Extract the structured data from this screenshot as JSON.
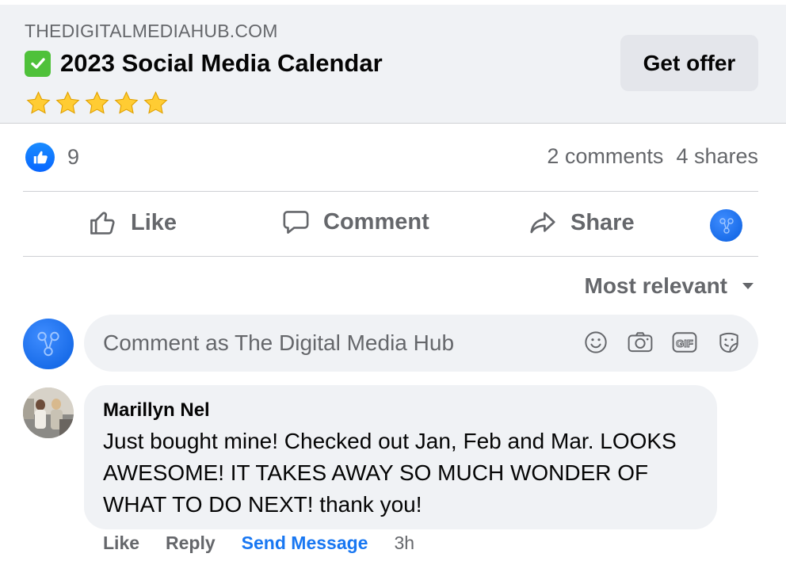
{
  "preview": {
    "domain": "THEDIGITALMEDIAHUB.COM",
    "title": "2023 Social Media Calendar",
    "rating_stars": 5,
    "cta_label": "Get offer"
  },
  "reactions": {
    "count": "9",
    "comments": "2 comments",
    "shares": "4 shares"
  },
  "actions": {
    "like": "Like",
    "comment": "Comment",
    "share": "Share"
  },
  "sort": {
    "label": "Most relevant"
  },
  "composer": {
    "placeholder": "Comment as The Digital Media Hub"
  },
  "comment": {
    "author": "Marillyn Nel",
    "text": "Just bought mine! Checked out Jan, Feb and Mar. LOOKS AWESOME! IT TAKES AWAY SO MUCH WONDER OF WHAT TO DO NEXT! thank you!",
    "actions": {
      "like": "Like",
      "reply": "Reply",
      "send_message": "Send Message",
      "time": "3h"
    }
  },
  "colors": {
    "accent": "#1877f2",
    "muted": "#65676b",
    "bubble": "#f0f2f5",
    "check": "#4fc13a"
  },
  "icons": [
    "check-icon",
    "star-icon",
    "like-badge-icon",
    "thumbs-up-icon",
    "comment-icon",
    "share-icon",
    "page-avatar-icon",
    "chevron-down-icon",
    "emoji-icon",
    "camera-icon",
    "gif-icon",
    "sticker-icon"
  ]
}
